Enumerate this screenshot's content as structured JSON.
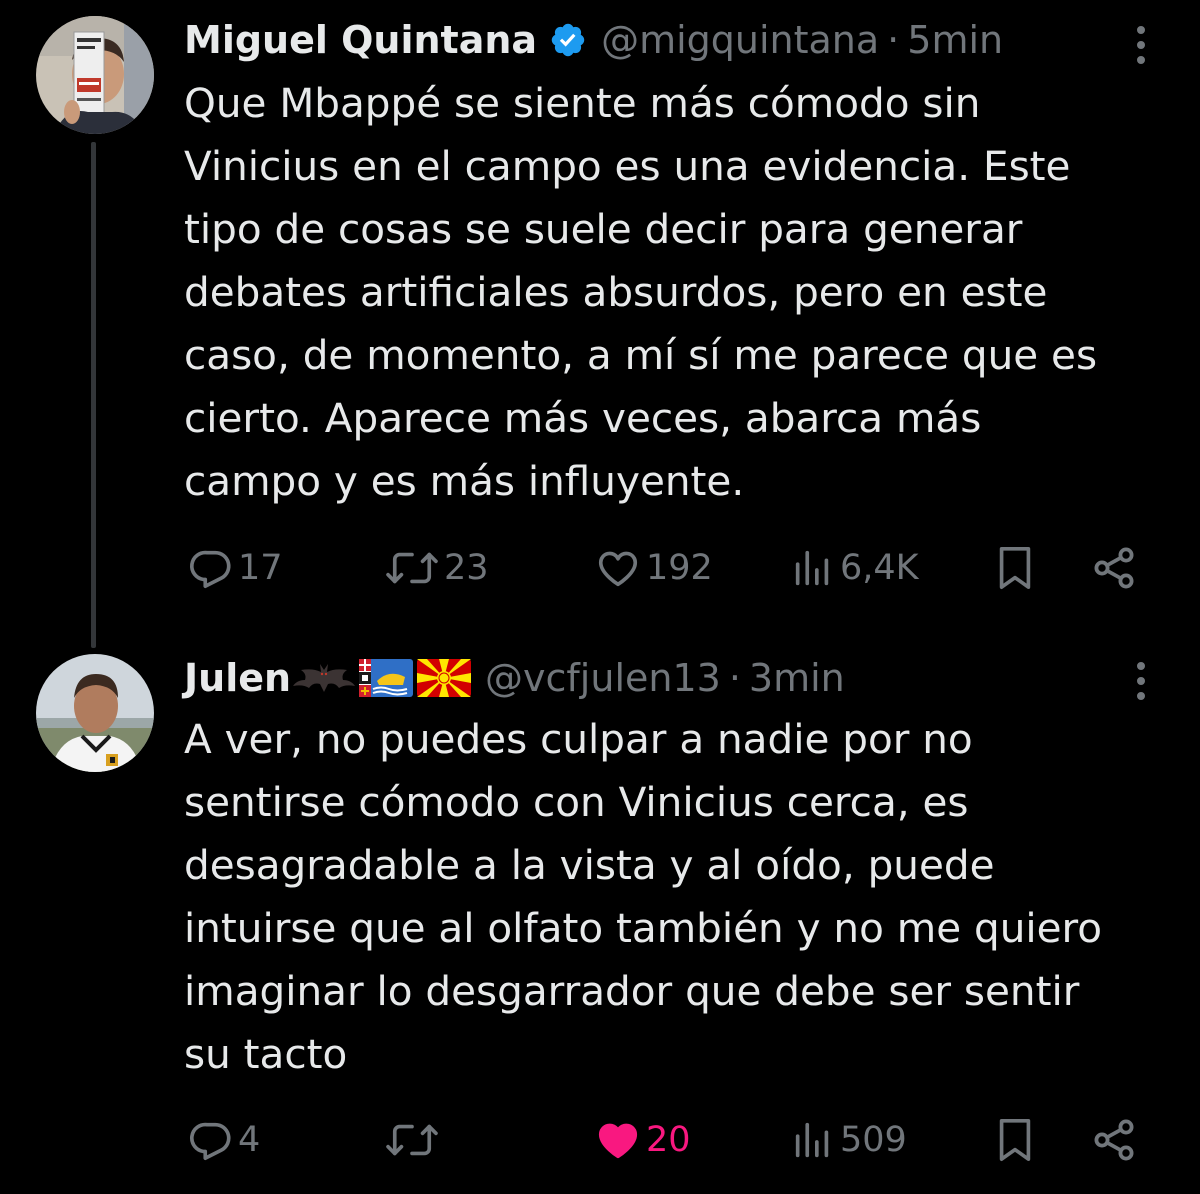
{
  "colors": {
    "background": "#000000",
    "text_primary": "#e7e9ea",
    "text_secondary": "#71767b",
    "verified_blue": "#1d9bf0",
    "like_active": "#f91880",
    "thread_line": "#333639"
  },
  "tweets": [
    {
      "author": {
        "name": "Miguel Quintana",
        "verified": true,
        "handle": "@migquintana",
        "avatar_icon": "avatar-holding-book"
      },
      "time": "5min",
      "lines": [
        "Que Mbappé se siente más cómodo sin",
        "Vinicius en el campo es una evidencia. Este",
        "tipo de cosas se suele decir para generar",
        "debates artificiales absurdos, pero en este",
        "caso, de momento, a mí sí me parece que es",
        "cierto. Aparece más veces, abarca más",
        "campo y es más influyente."
      ],
      "stats": {
        "replies": "17",
        "retweets": "23",
        "likes": "192",
        "views": "6,4K"
      },
      "liked": false
    },
    {
      "author": {
        "name": "Julen",
        "name_emojis": [
          "bat-emoji",
          "flag-saint-pierre-miquelon-emoji",
          "flag-north-macedonia-emoji"
        ],
        "handle": "@vcfjulen13",
        "avatar_icon": "avatar-man-in-jersey"
      },
      "time": "3min",
      "lines": [
        "A ver, no puedes culpar a nadie por no",
        "sentirse cómodo con Vinicius cerca, es",
        "desagradable a la vista y al oído, puede",
        "intuirse que al olfato también y no me quiero",
        "imaginar lo desgarrador que debe ser sentir",
        "su tacto"
      ],
      "stats": {
        "replies": "4",
        "retweets": "",
        "likes": "20",
        "views": "509"
      },
      "liked": true
    }
  ],
  "icons": {
    "separator": "·",
    "reply": "reply-icon",
    "retweet": "retweet-icon",
    "like": "heart-icon",
    "views": "views-icon",
    "bookmark": "bookmark-icon",
    "share": "share-icon",
    "more": "more-vertical-icon"
  }
}
